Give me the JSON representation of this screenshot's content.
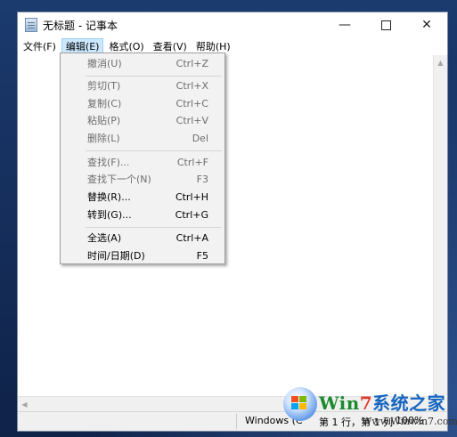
{
  "window": {
    "title": "无标题 - 记事本",
    "controls": {
      "minimize": "—",
      "maximize": "",
      "close": "✕"
    }
  },
  "menubar": {
    "items": [
      {
        "label": "文件(F)",
        "active": false
      },
      {
        "label": "编辑(E)",
        "active": true
      },
      {
        "label": "格式(O)",
        "active": false
      },
      {
        "label": "查看(V)",
        "active": false
      },
      {
        "label": "帮助(H)",
        "active": false
      }
    ]
  },
  "edit_menu": {
    "items": [
      {
        "label": "撤消(U)",
        "shortcut": "Ctrl+Z",
        "enabled": false
      },
      {
        "label": "剪切(T)",
        "shortcut": "Ctrl+X",
        "enabled": false
      },
      {
        "label": "复制(C)",
        "shortcut": "Ctrl+C",
        "enabled": false
      },
      {
        "label": "粘贴(P)",
        "shortcut": "Ctrl+V",
        "enabled": false
      },
      {
        "label": "删除(L)",
        "shortcut": "Del",
        "enabled": false
      },
      {
        "label": "查找(F)...",
        "shortcut": "Ctrl+F",
        "enabled": false
      },
      {
        "label": "查找下一个(N)",
        "shortcut": "F3",
        "enabled": false
      },
      {
        "label": "替换(R)...",
        "shortcut": "Ctrl+H",
        "enabled": true
      },
      {
        "label": "转到(G)...",
        "shortcut": "Ctrl+G",
        "enabled": true
      },
      {
        "label": "全选(A)",
        "shortcut": "Ctrl+A",
        "enabled": true
      },
      {
        "label": "时间/日期(D)",
        "shortcut": "F5",
        "enabled": true
      }
    ]
  },
  "statusbar": {
    "line_ending": "Windows (C",
    "position": "第 1 行，第 1 列",
    "zoom": "100%"
  },
  "scroll": {
    "up": "▲",
    "left": "◀"
  },
  "watermark": {
    "brand_prefix": "Win",
    "brand_seven": "7",
    "brand_suffix": "系统之家",
    "url": "Www.Winwin7.com"
  },
  "colors": {
    "menu_active_bg": "#cce8ff",
    "menu_active_border": "#99d1ff",
    "disabled_text": "#6d6d6d",
    "desktop": "#1d2f57"
  }
}
